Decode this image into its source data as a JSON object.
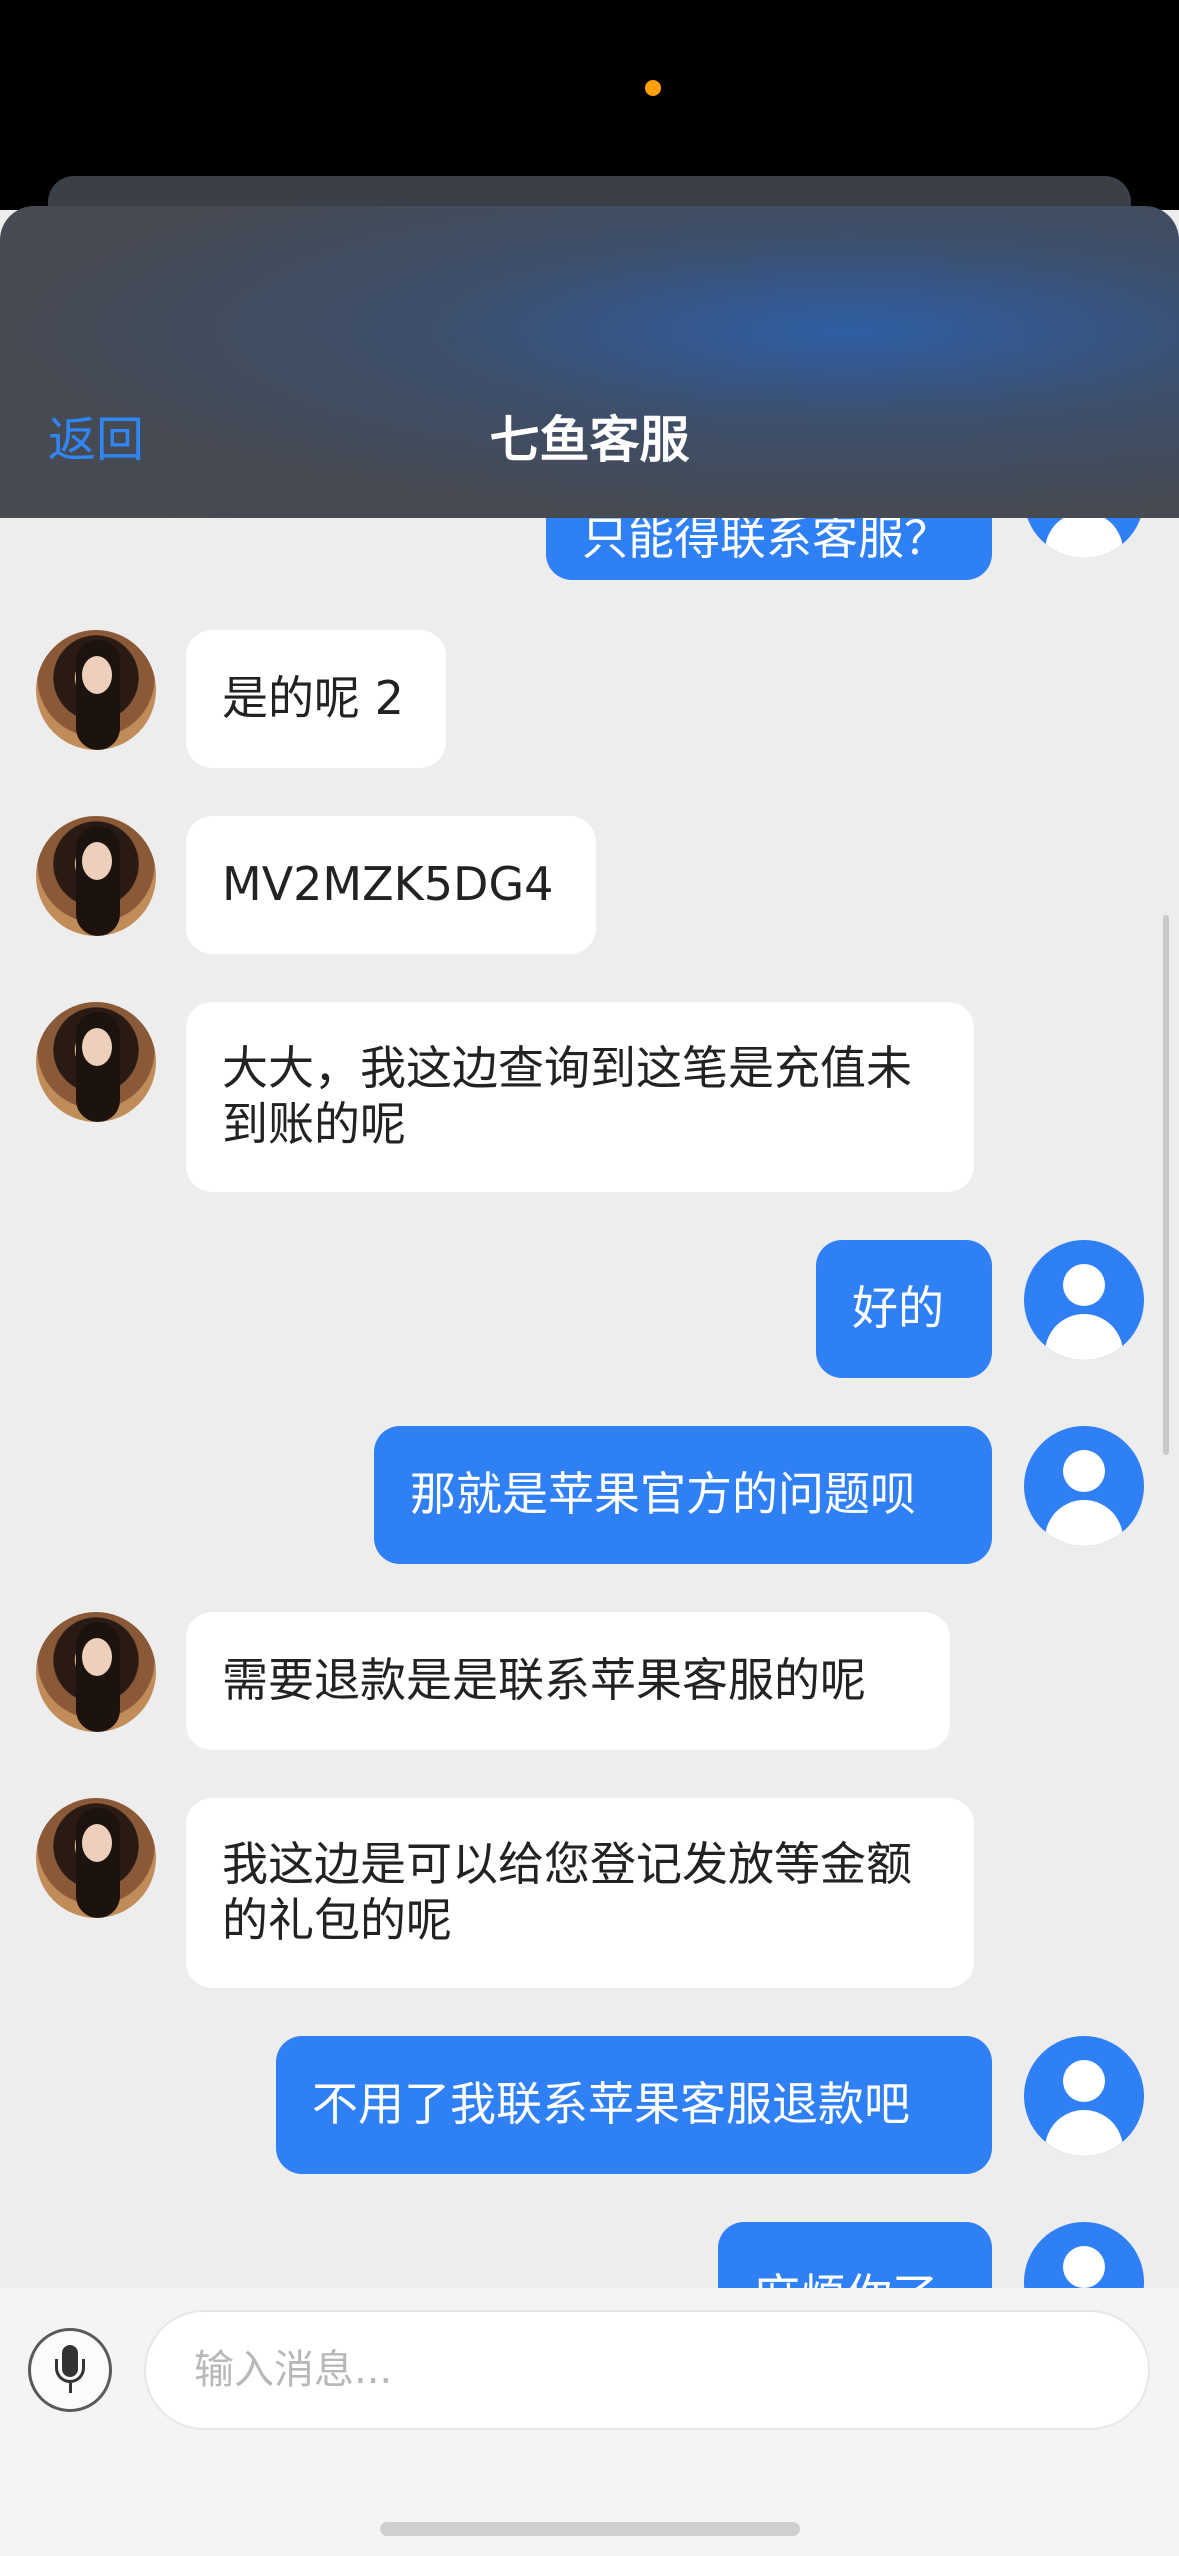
{
  "header": {
    "back_label": "返回",
    "title": "七鱼客服"
  },
  "messages": [
    {
      "sender": "user",
      "text": "只能得联系客服？"
    },
    {
      "sender": "agent",
      "text": "是的呢 2"
    },
    {
      "sender": "agent",
      "text": "MV2MZK5DG4"
    },
    {
      "sender": "agent",
      "text": "大大，我这边查询到这笔是充值未到账的呢"
    },
    {
      "sender": "user",
      "text": "好的"
    },
    {
      "sender": "user",
      "text": "那就是苹果官方的问题呗"
    },
    {
      "sender": "agent",
      "text": "需要退款是是联系苹果客服的呢"
    },
    {
      "sender": "agent",
      "text": "我这边是可以给您登记发放等金额的礼包的呢"
    },
    {
      "sender": "user",
      "text": "不用了我联系苹果客服退款吧"
    },
    {
      "sender": "user",
      "text": "麻烦你了"
    }
  ],
  "input": {
    "placeholder": "输入消息..."
  },
  "colors": {
    "accent": "#2f7ff5",
    "back_link": "#2f86f6",
    "chat_background": "#ededed"
  }
}
